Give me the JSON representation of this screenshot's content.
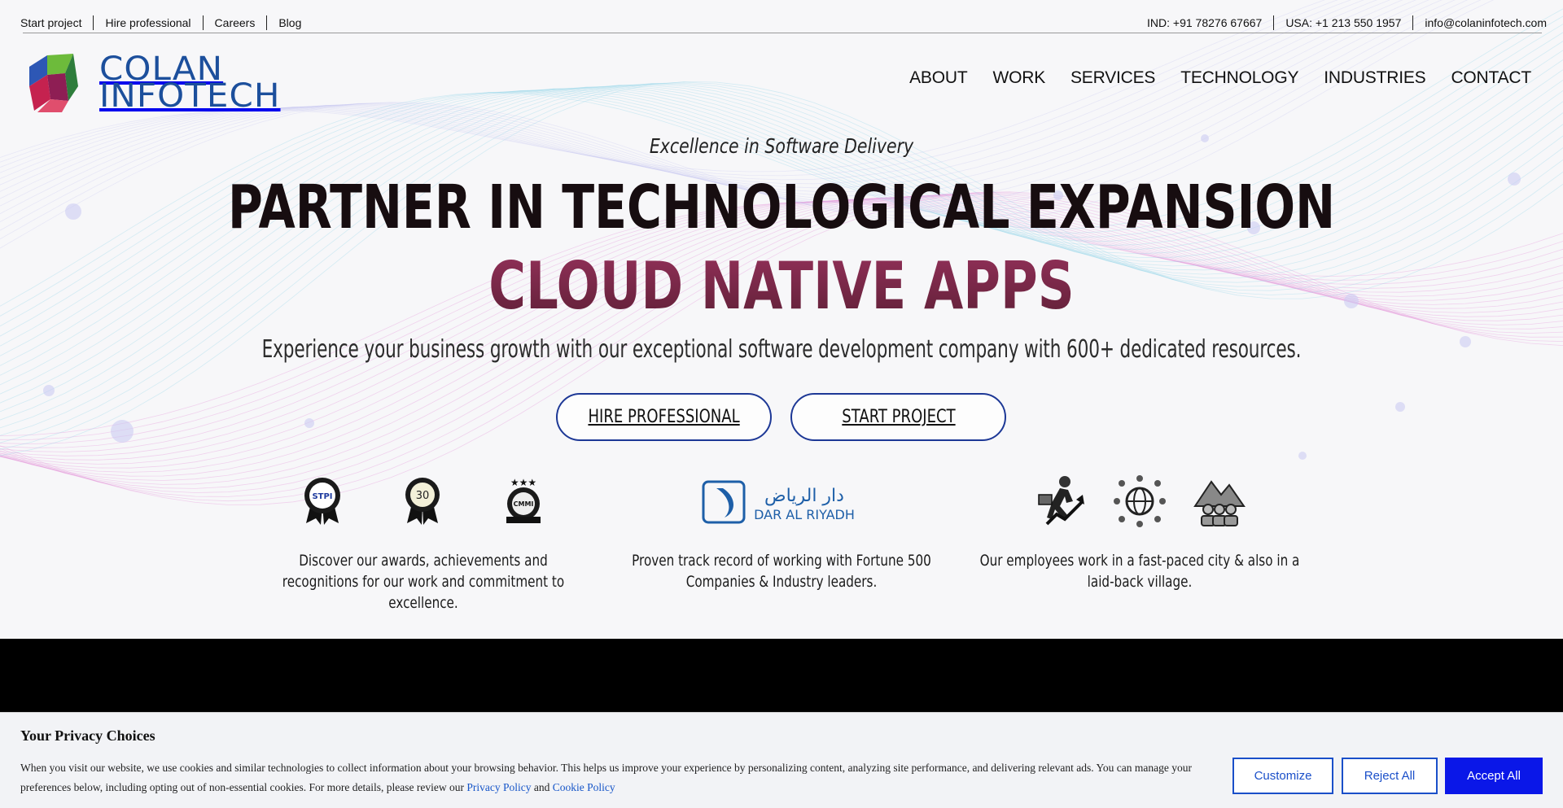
{
  "topbar": {
    "left_links": [
      "Start project",
      "Hire professional",
      "Careers",
      "Blog"
    ],
    "contacts": [
      "IND: +91 78276 67667",
      "USA: +1 213 550 1957",
      "info@colaninfotech.com"
    ]
  },
  "logo": {
    "line1": "COLAN",
    "line2": "INFOTECH"
  },
  "nav": [
    "ABOUT",
    "WORK",
    "SERVICES",
    "TECHNOLOGY",
    "INDUSTRIES",
    "CONTACT"
  ],
  "hero": {
    "tagline": "Excellence in Software Delivery",
    "headline": "PARTNER IN TECHNOLOGICAL EXPANSION",
    "rotating_text": "CLOUD NATIVE APPS",
    "subline": "Experience your business growth with our exceptional software development company with 600+ dedicated resources.",
    "cta_hire": "HIRE PROFESSIONAL",
    "cta_start": "START PROJECT"
  },
  "proof": {
    "awards": {
      "badges": [
        "STPI",
        "30",
        "CMMI"
      ],
      "text": "Discover our awards, achievements and recognitions for our work and commitment to excellence."
    },
    "clients": {
      "logo_arabic": "دار الرياض",
      "logo_latin": "DAR AL RIYADH",
      "text": "Proven track record of working with Fortune 500 Companies & Industry leaders."
    },
    "employees": {
      "text": "Our employees work in a fast-paced city & also in a laid-back village."
    }
  },
  "cookie": {
    "title": "Your Privacy Choices",
    "description": "When you visit our website, we use cookies and similar technologies to collect information about your browsing behavior. This helps us improve your experience by personalizing content, analyzing site performance, and delivering relevant ads. You can manage your preferences below, including opting out of non-essential cookies. For more details, please review our",
    "privacy_link": "Privacy Policy",
    "and": "and",
    "cookie_link": "Cookie Policy",
    "btn_customize": "Customize",
    "btn_reject": "Reject All",
    "btn_accept": "Accept All"
  },
  "colors": {
    "brand_blue": "#1c4f9c",
    "accent_maroon": "#7a2a48",
    "accept_blue": "#0a17e8"
  }
}
